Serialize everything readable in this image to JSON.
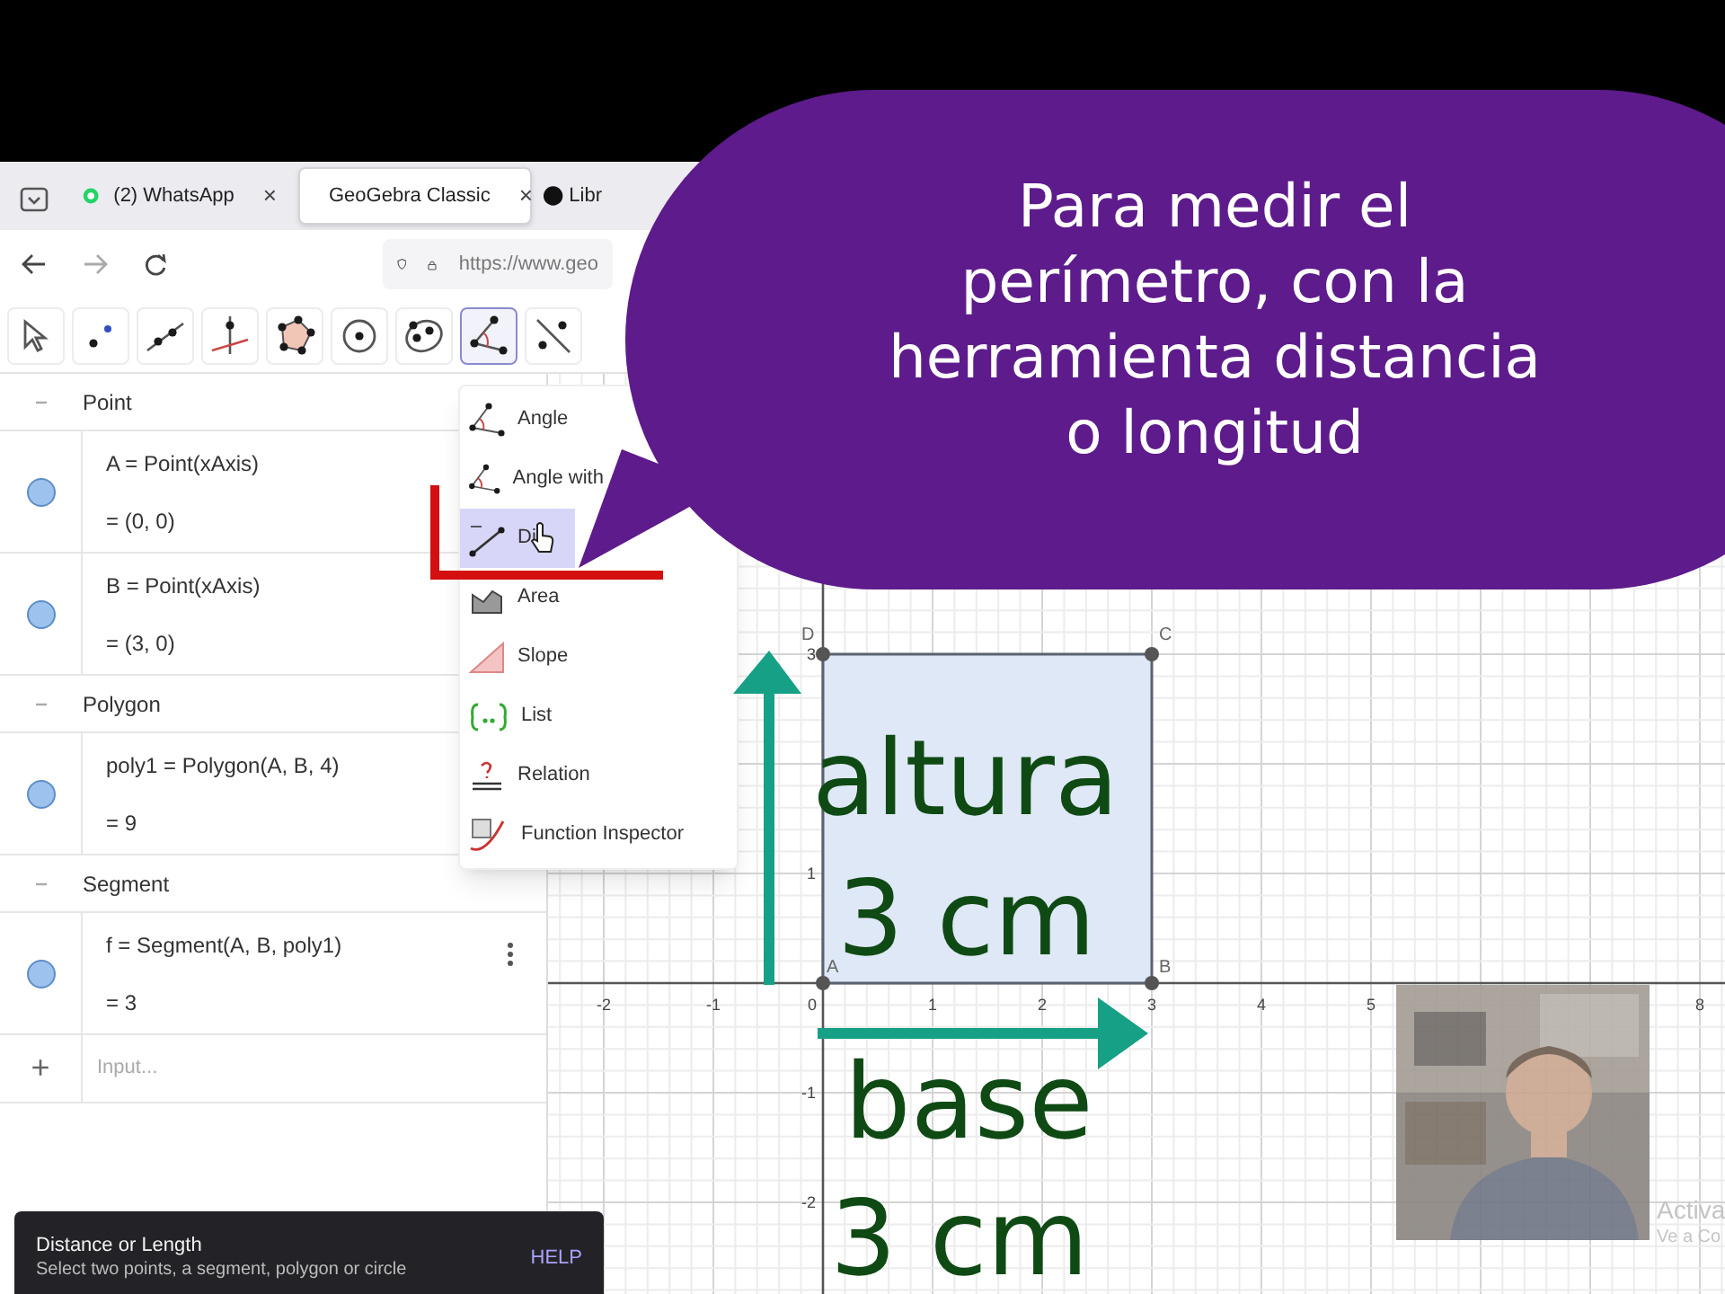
{
  "browser": {
    "tabs": [
      {
        "kind": "whatsapp",
        "label": "(2) WhatsApp",
        "selected": false,
        "close": "×"
      },
      {
        "kind": "geogebra",
        "label": "GeoGebra Classic",
        "selected": true,
        "close": "×"
      },
      {
        "kind": "library",
        "label": "Libr",
        "selected": false
      }
    ],
    "url": "https://www.geo"
  },
  "toolbar": [
    {
      "kind": "move",
      "selected": false
    },
    {
      "kind": "point",
      "selected": false
    },
    {
      "kind": "line",
      "selected": false
    },
    {
      "kind": "perpendicular",
      "selected": false
    },
    {
      "kind": "polygon",
      "selected": false
    },
    {
      "kind": "circle",
      "selected": false
    },
    {
      "kind": "conic",
      "selected": false
    },
    {
      "kind": "angle",
      "selected": true
    },
    {
      "kind": "reflect",
      "selected": false
    }
  ],
  "algebra": {
    "groups": [
      {
        "header": "Point",
        "items": [
          {
            "definition": "A = Point(xAxis)",
            "value": "= (0, 0)"
          },
          {
            "definition": "B = Point(xAxis)",
            "value": "= (3, 0)"
          }
        ]
      },
      {
        "header": "Polygon",
        "items": [
          {
            "definition": "poly1 = Polygon(A, B, 4)",
            "value": "= 9"
          }
        ]
      },
      {
        "header": "Segment",
        "items": [
          {
            "definition": "f = Segment(A, B, poly1)",
            "value": "= 3",
            "menu": true
          }
        ]
      }
    ],
    "input": {
      "add": "+",
      "placeholder": "Input..."
    }
  },
  "tool_menu": [
    {
      "kind": "angle",
      "label": "Angle",
      "selected": false
    },
    {
      "kind": "angle-size",
      "label": "Angle with",
      "selected": false
    },
    {
      "kind": "distance",
      "label": "Di",
      "selected": true
    },
    {
      "kind": "area",
      "label": "Area",
      "selected": false
    },
    {
      "kind": "slope",
      "label": "Slope",
      "selected": false
    },
    {
      "kind": "list",
      "label": "List",
      "selected": false
    },
    {
      "kind": "relation",
      "label": "Relation",
      "selected": false
    },
    {
      "kind": "inspector",
      "label": "Function Inspector",
      "selected": false
    }
  ],
  "tooltip": {
    "title": "Distance or Length",
    "description": "Select two points, a segment, polygon or circle",
    "help": "HELP"
  },
  "graphics": {
    "x_ticks": [
      "-2",
      "-1",
      "0",
      "1",
      "2",
      "3",
      "4",
      "5",
      "8"
    ],
    "y_ticks": [
      "3",
      "1",
      "-1",
      "-2"
    ],
    "points": [
      "D",
      "C",
      "A",
      "B"
    ]
  },
  "activation": [
    "Activa",
    "Ve a Co"
  ],
  "callout": {
    "lines": [
      "Para medir el",
      "perímetro, con la",
      "herramienta distancia",
      "o longitud"
    ]
  },
  "height_label": [
    "altura",
    "3 cm"
  ],
  "base_label": [
    "base",
    "3 cm"
  ]
}
